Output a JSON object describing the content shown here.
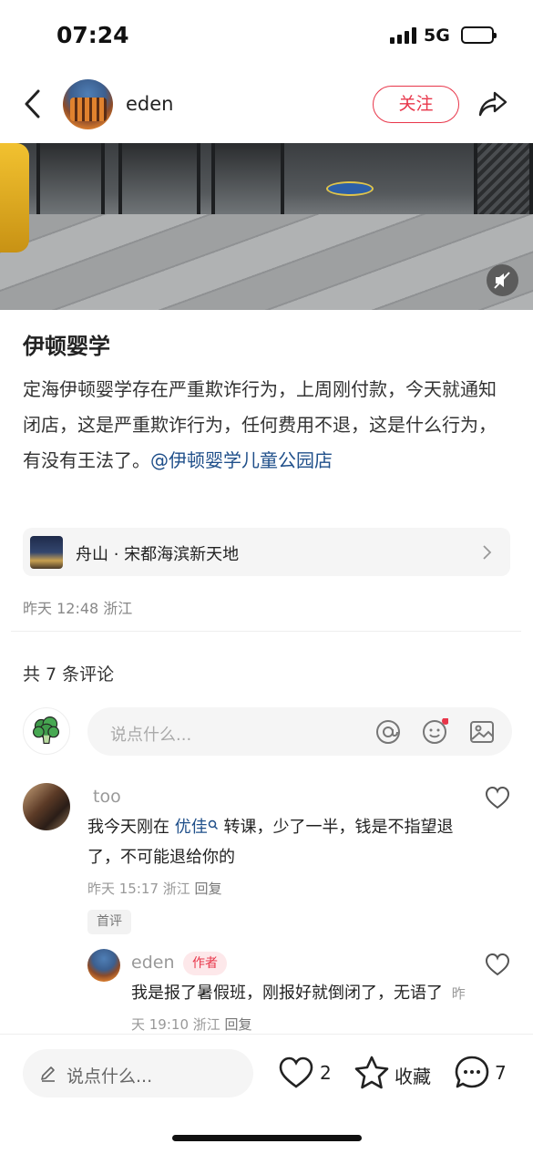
{
  "status_bar": {
    "time": "07:24",
    "network": "5G"
  },
  "nav": {
    "username": "eden",
    "follow_label": "关注"
  },
  "post": {
    "title": "伊顿婴学",
    "body": "定海伊顿婴学存在严重欺诈行为，上周刚付款，今天就通知闭店，这是严重欺诈行为，任何费用不退，这是什么行为，有没有王法了。",
    "mention": "@伊顿婴学儿童公园店",
    "location": "舟山 · 宋都海滨新天地",
    "meta": "昨天 12:48 浙江"
  },
  "comments_header": {
    "count_label": "共 7 条评论"
  },
  "comment_input": {
    "placeholder": "说点什么..."
  },
  "comments": [
    {
      "user": "too",
      "text_before": "我今天刚在 ",
      "link": "优佳",
      "text_after": " 转课，少了一半，钱是不指望退了，不可能退给你的",
      "time_loc": "昨天 15:17 浙江",
      "reply_label": "回复",
      "tag": "首评"
    },
    {
      "user": "eden",
      "author_tag": "作者",
      "text": "我是报了暑假班，刚报好就倒闭了，无语了",
      "time_loc": "昨天 19:10 浙江",
      "reply_label": "回复"
    }
  ],
  "bottom_bar": {
    "input_placeholder": "说点什么...",
    "likes": "2",
    "collect_label": "收藏",
    "comments": "7"
  },
  "colors": {
    "accent": "#e8364a",
    "link": "#1f4f8a"
  }
}
